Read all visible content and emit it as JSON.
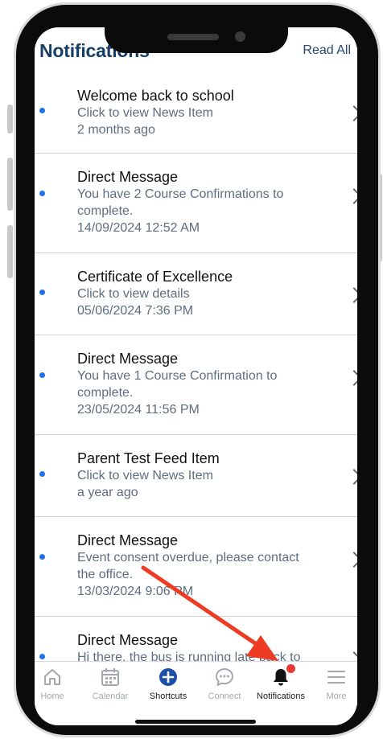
{
  "header": {
    "title": "Notifications",
    "read_all_label": "Read All"
  },
  "notifications": [
    {
      "title": "Welcome back to school",
      "body": "Click to view News Item",
      "date": "2 months ago",
      "unread": true
    },
    {
      "title": "Direct Message",
      "body": "You have 2 Course Confirmations to complete.",
      "date": "14/09/2024 12:52 AM",
      "unread": true
    },
    {
      "title": "Certificate of Excellence",
      "body": "Click to view details",
      "date": "05/06/2024 7:36 PM",
      "unread": true
    },
    {
      "title": "Direct Message",
      "body": "You have 1 Course Confirmation to complete.",
      "date": "23/05/2024 11:56 PM",
      "unread": true
    },
    {
      "title": "Parent Test Feed Item",
      "body": "Click to view News Item",
      "date": "a year ago",
      "unread": true
    },
    {
      "title": "Direct Message",
      "body": "Event consent overdue, please contact the office.",
      "date": "13/03/2024 9:06 PM",
      "unread": true
    },
    {
      "title": "Direct Message",
      "body": "Hi there, the bus is running late back to",
      "date": "",
      "unread": true
    }
  ],
  "tabbar": {
    "items": [
      {
        "label": "Home",
        "icon": "home-icon",
        "active": false
      },
      {
        "label": "Calendar",
        "icon": "calendar-icon",
        "active": false
      },
      {
        "label": "Shortcuts",
        "icon": "plus-circle-icon",
        "active": true
      },
      {
        "label": "Connect",
        "icon": "chat-bubble-icon",
        "active": false
      },
      {
        "label": "Notifications",
        "icon": "bell-icon",
        "active": true
      },
      {
        "label": "More",
        "icon": "menu-icon",
        "active": false
      }
    ]
  },
  "colors": {
    "title": "#173f66",
    "unread_dot": "#1f73e8",
    "shortcuts_accent": "#1c4fa8",
    "badge": "#e53935",
    "annotation_arrow": "#ee3b24"
  }
}
